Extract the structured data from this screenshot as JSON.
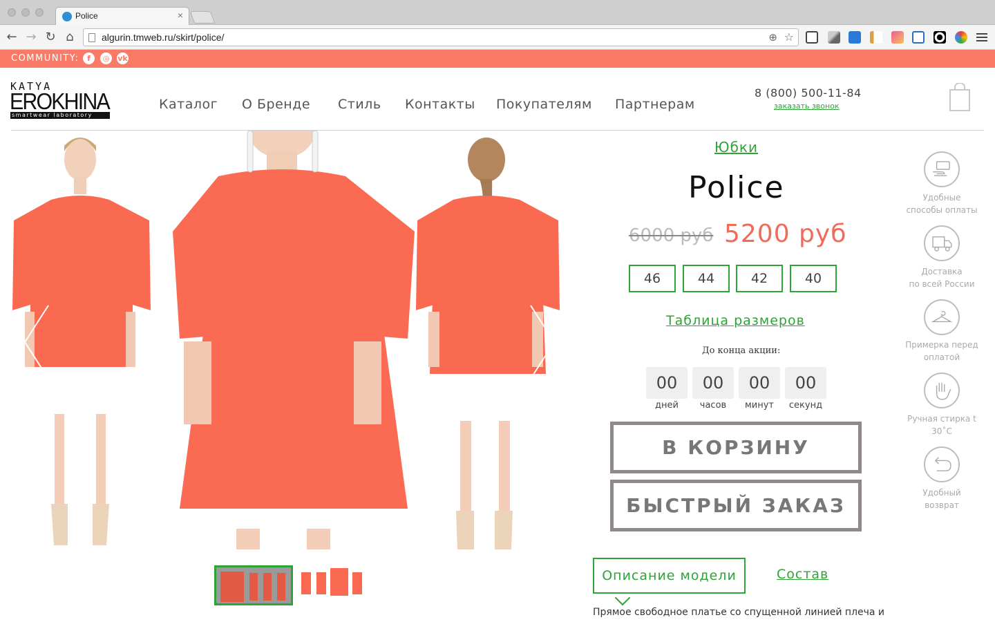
{
  "browser": {
    "tab_title": "Police",
    "tab_close": "×",
    "url": "algurin.tmweb.ru/skirt/police/"
  },
  "community": {
    "label": "COMMUNITY:",
    "icons": [
      "facebook-icon",
      "instagram-icon",
      "vk-icon"
    ]
  },
  "logo": {
    "top": "KATYA",
    "main": "EROKHINA",
    "sub": "smartwear laboratory"
  },
  "nav": {
    "catalog": "Каталог",
    "brand": "О Бренде",
    "style": "Стиль",
    "contacts": "Контакты",
    "buyers": "Покупателям",
    "partners": "Партнерам"
  },
  "contact": {
    "phone": "8 (800) 500-11-84",
    "callback": "заказать звонок"
  },
  "product": {
    "category": "Юбки",
    "title": "Police",
    "old_price": "6000 руб",
    "new_price": "5200 руб",
    "sizes": [
      "46",
      "44",
      "42",
      "40"
    ],
    "size_chart": "Таблица размеров",
    "promo_label": "До конца акции:",
    "timer": {
      "days_value": "00",
      "days_unit": "дней",
      "hours_value": "00",
      "hours_unit": "часов",
      "minutes_value": "00",
      "minutes_unit": "минут",
      "seconds_value": "00",
      "seconds_unit": "секунд"
    },
    "add_to_cart": "В КОРЗИНУ",
    "quick_order": "БЫСТРЫЙ ЗАКАЗ",
    "tab_description": "Описание модели",
    "tab_composition": "Состав",
    "description": "Прямое свободное платье со спущенной линией плеча и"
  },
  "features": [
    {
      "icon": "card-payment-icon",
      "line1": "Удобные",
      "line2": "способы оплаты"
    },
    {
      "icon": "delivery-truck-icon",
      "line1": "Доставка",
      "line2": "по всей России"
    },
    {
      "icon": "hanger-icon",
      "line1": "Примерка перед",
      "line2": "оплатой"
    },
    {
      "icon": "hand-wash-icon",
      "line1": "Ручная стирка t",
      "line2": "30˚С"
    },
    {
      "icon": "return-arrow-icon",
      "line1": "Удобный",
      "line2": "возврат"
    }
  ],
  "colors": {
    "accent_coral": "#f97a66",
    "price_red": "#f26a58",
    "link_green": "#2ea336",
    "button_border": "#8f8a89"
  }
}
